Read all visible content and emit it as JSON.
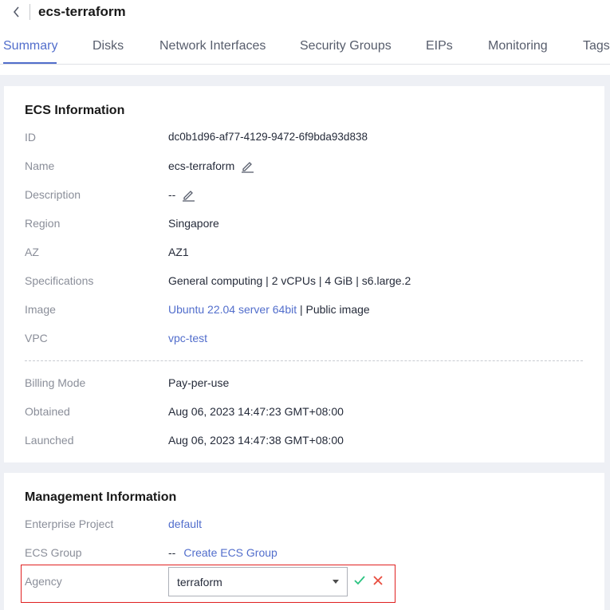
{
  "header": {
    "title": "ecs-terraform"
  },
  "tabs": [
    {
      "label": "Summary",
      "active": true
    },
    {
      "label": "Disks"
    },
    {
      "label": "Network Interfaces"
    },
    {
      "label": "Security Groups"
    },
    {
      "label": "EIPs"
    },
    {
      "label": "Monitoring"
    },
    {
      "label": "Tags"
    }
  ],
  "ecs_info": {
    "title": "ECS Information",
    "id": {
      "label": "ID",
      "value": "dc0b1d96-af77-4129-9472-6f9bda93d838"
    },
    "name": {
      "label": "Name",
      "value": "ecs-terraform"
    },
    "description": {
      "label": "Description",
      "value": "--"
    },
    "region": {
      "label": "Region",
      "value": "Singapore"
    },
    "az": {
      "label": "AZ",
      "value": "AZ1"
    },
    "specifications": {
      "label": "Specifications",
      "value": "General computing | 2 vCPUs | 4 GiB | s6.large.2"
    },
    "image": {
      "label": "Image",
      "link": "Ubuntu 22.04 server 64bit",
      "suffix": " | Public image"
    },
    "vpc": {
      "label": "VPC",
      "link": "vpc-test"
    },
    "billing_mode": {
      "label": "Billing Mode",
      "value": "Pay-per-use"
    },
    "obtained": {
      "label": "Obtained",
      "value": "Aug 06, 2023 14:47:23 GMT+08:00"
    },
    "launched": {
      "label": "Launched",
      "value": "Aug 06, 2023 14:47:38 GMT+08:00"
    }
  },
  "management_info": {
    "title": "Management Information",
    "enterprise_project": {
      "label": "Enterprise Project",
      "link": "default"
    },
    "ecs_group": {
      "label": "ECS Group",
      "value": "--",
      "link": "Create ECS Group"
    },
    "agency": {
      "label": "Agency",
      "selected": "terraform"
    }
  },
  "colors": {
    "accent": "#526ecc",
    "confirm": "#2ac380",
    "cancel": "#e84c3d",
    "highlight_border": "#e02020",
    "background": "#eef0f5"
  },
  "icons": {
    "back": "chevron-left-icon",
    "edit": "edit-pencil-icon",
    "confirm": "check-icon",
    "cancel": "close-icon",
    "select_caret": "caret-down-icon"
  }
}
